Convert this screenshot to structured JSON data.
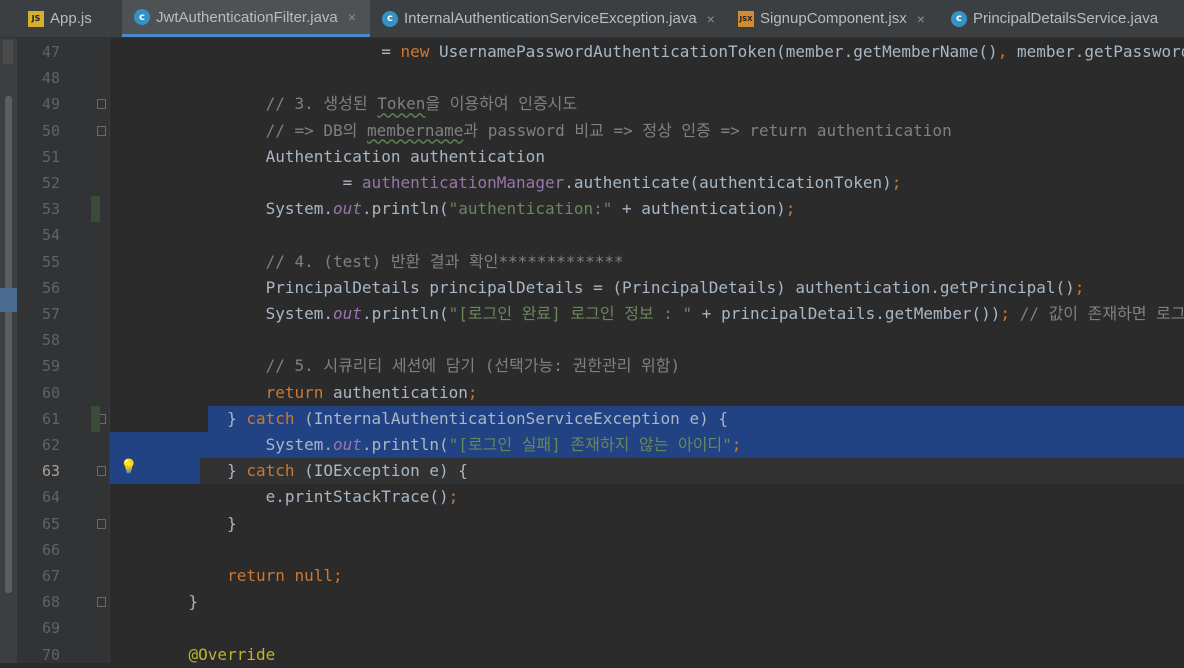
{
  "tabs": [
    {
      "label": "App.js",
      "icon": "js-file-icon",
      "active": false
    },
    {
      "label": "JwtAuthenticationFilter.java",
      "icon": "java-class-icon",
      "active": true
    },
    {
      "label": "InternalAuthenticationServiceException.java",
      "icon": "java-exception-class-icon",
      "active": false
    },
    {
      "label": "SignupComponent.jsx",
      "icon": "jsx-file-icon",
      "active": false
    },
    {
      "label": "PrincipalDetailsService.java",
      "icon": "java-class-icon",
      "active": false
    }
  ],
  "tab_icon_text": {
    "js": "JS",
    "jsx": "JSX",
    "cls": "c"
  },
  "close_glyph": "×",
  "lines": [
    {
      "n": "47",
      "code": [
        [
          "",
          "                        = "
        ],
        [
          "kw",
          "new "
        ],
        [
          "",
          "UsernamePasswordAuthenticationToken(member.getMemberName()"
        ],
        [
          "kw",
          ", "
        ],
        [
          "",
          "member.getPassword())"
        ],
        [
          "kw",
          ";"
        ]
      ]
    },
    {
      "n": "48",
      "code": []
    },
    {
      "n": "49",
      "code": [
        [
          "cm",
          "            // 3. 생성된 "
        ],
        [
          "cm squig",
          "Token"
        ],
        [
          "cm",
          "을 이용하여 인증시도"
        ]
      ]
    },
    {
      "n": "50",
      "code": [
        [
          "cm",
          "            // => DB의 "
        ],
        [
          "cm squig",
          "membername"
        ],
        [
          "cm",
          "과 password 비교 => 정상 인증 => return authentication"
        ]
      ]
    },
    {
      "n": "51",
      "code": [
        [
          "",
          "            Authentication authentication"
        ]
      ]
    },
    {
      "n": "52",
      "code": [
        [
          "",
          "                    = "
        ],
        [
          "mem",
          "authenticationManager"
        ],
        [
          "",
          ".authenticate(authenticationToken)"
        ],
        [
          "kw",
          ";"
        ]
      ]
    },
    {
      "n": "53",
      "code": [
        [
          "",
          "            System."
        ],
        [
          "fld",
          "out"
        ],
        [
          "",
          ".println("
        ],
        [
          "str",
          "\"authentication:\""
        ],
        [
          "",
          " + authentication)"
        ],
        [
          "kw",
          ";"
        ]
      ]
    },
    {
      "n": "54",
      "code": []
    },
    {
      "n": "55",
      "code": [
        [
          "cm",
          "            // 4. (test) 반환 결과 확인*************"
        ]
      ]
    },
    {
      "n": "56",
      "code": [
        [
          "",
          "            PrincipalDetails principalDetails = (PrincipalDetails) authentication.getPrincipal()"
        ],
        [
          "kw",
          ";"
        ]
      ]
    },
    {
      "n": "57",
      "code": [
        [
          "",
          "            System."
        ],
        [
          "fld",
          "out"
        ],
        [
          "",
          ".println("
        ],
        [
          "str",
          "\"[로그인 완료] 로그인 정보 : \""
        ],
        [
          "",
          " + principalDetails.getMember())"
        ],
        [
          "kw",
          "; "
        ],
        [
          "cm",
          "// 값이 존재하면 로그인"
        ]
      ]
    },
    {
      "n": "58",
      "code": []
    },
    {
      "n": "59",
      "code": [
        [
          "cm",
          "            // 5. 시큐리티 세션에 담기 (선택가능: 권한관리 위함)"
        ]
      ]
    },
    {
      "n": "60",
      "code": [
        [
          "kw",
          "            return "
        ],
        [
          "",
          "authentication"
        ],
        [
          "kw",
          ";"
        ]
      ]
    },
    {
      "n": "61",
      "code": [
        [
          "",
          "        } "
        ],
        [
          "kw",
          "catch "
        ],
        [
          "",
          "(InternalAuthenticationServiceException e) {"
        ]
      ]
    },
    {
      "n": "62",
      "code": [
        [
          "",
          "            System."
        ],
        [
          "fld",
          "out"
        ],
        [
          "",
          ".println("
        ],
        [
          "str",
          "\"[로그인 실패] 존재하지 않는 아이디\""
        ],
        [
          ")"
        ],
        [
          "kw",
          ";"
        ]
      ]
    },
    {
      "n": "63",
      "code": [
        [
          "",
          "        } "
        ],
        [
          "kw",
          "catch "
        ],
        [
          "",
          "(IOException e) {"
        ]
      ]
    },
    {
      "n": "64",
      "code": [
        [
          "",
          "            e.printStackTrace()"
        ],
        [
          "kw",
          ";"
        ]
      ]
    },
    {
      "n": "65",
      "code": [
        [
          "",
          "        }"
        ]
      ]
    },
    {
      "n": "66",
      "code": []
    },
    {
      "n": "67",
      "code": [
        [
          "kw",
          "        return null"
        ],
        [
          "kw",
          ";"
        ]
      ]
    },
    {
      "n": "68",
      "code": [
        [
          "",
          "    }"
        ]
      ]
    },
    {
      "n": "69",
      "code": []
    },
    {
      "n": "70",
      "code": [
        [
          "ann",
          "    @Override"
        ]
      ]
    }
  ],
  "current_line": "63",
  "colors": {
    "keyword": "#cc7832",
    "comment": "#808080",
    "string": "#6a8759",
    "field": "#9876aa",
    "selection": "#214283",
    "background": "#2b2b2b"
  }
}
